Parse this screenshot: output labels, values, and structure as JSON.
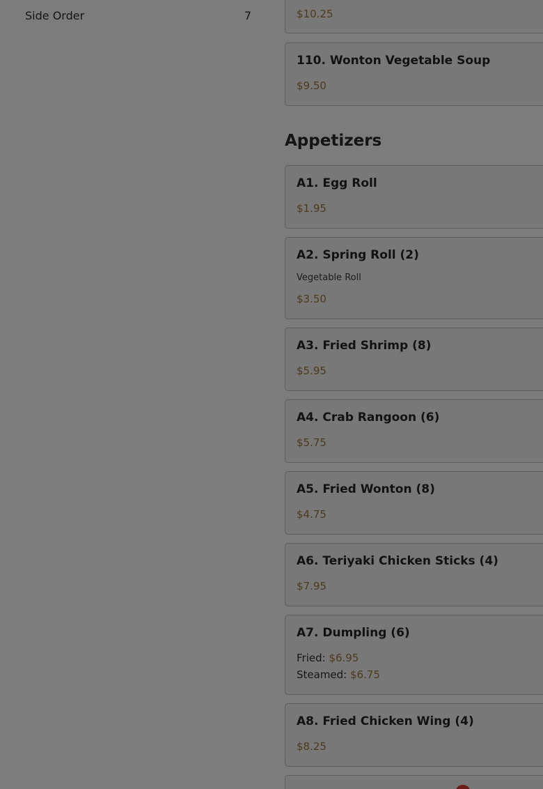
{
  "sidebar": {
    "item": {
      "label": "Side Order",
      "count": "7"
    }
  },
  "previous_items": [
    {
      "price": "$10.25"
    },
    {
      "title": "110. Wonton Vegetable Soup",
      "price": "$9.50"
    }
  ],
  "section": {
    "heading": "Appetizers",
    "items": [
      {
        "title": "A1. Egg Roll",
        "price": "$1.95"
      },
      {
        "title": "A2. Spring Roll (2)",
        "description": "Vegetable Roll",
        "price": "$3.50"
      },
      {
        "title": "A3. Fried Shrimp (8)",
        "price": "$5.95"
      },
      {
        "title": "A4. Crab Rangoon (6)",
        "price": "$5.75"
      },
      {
        "title": "A5. Fried Wonton (8)",
        "price": "$4.75"
      },
      {
        "title": "A6. Teriyaki Chicken Sticks (4)",
        "price": "$7.95"
      },
      {
        "title": "A7. Dumpling (6)",
        "options": [
          {
            "label": "Fried:",
            "price": "$6.95"
          },
          {
            "label": "Steamed:",
            "price": "$6.75"
          }
        ]
      },
      {
        "title": "A8. Fried Chicken Wing (4)",
        "price": "$8.25"
      }
    ]
  },
  "colors": {
    "overlay_background": "#7c7c7c",
    "price": "#4d3a1b",
    "badge": "#6a1b14"
  }
}
